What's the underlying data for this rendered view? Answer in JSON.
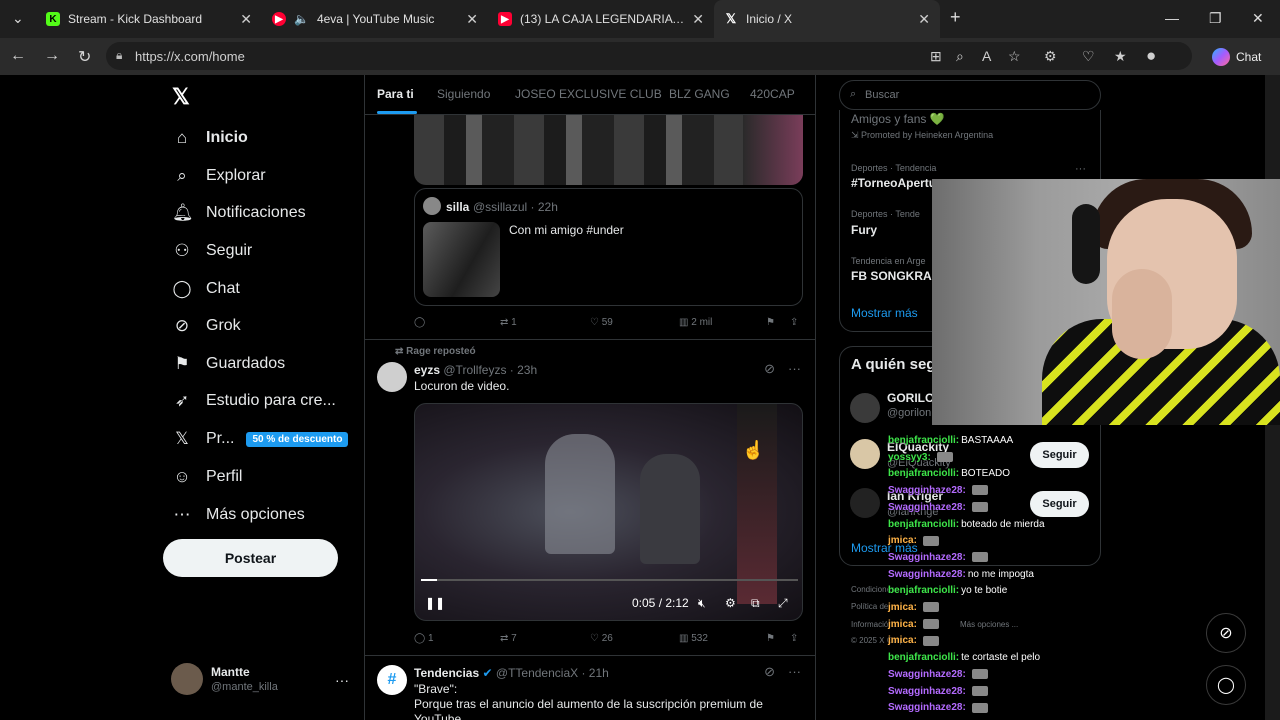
{
  "browser": {
    "tabs": [
      {
        "label": "Stream - Kick Dashboard",
        "icon": "kick-icon",
        "color": "#53fc18"
      },
      {
        "label": "4eva | YouTube Music",
        "icon": "youtube-music-icon",
        "color": "#ff0033"
      },
      {
        "label": "(13) LA CAJA LEGENDARIA - YouTube",
        "icon": "youtube-icon",
        "color": "#ff0033"
      },
      {
        "label": "Inicio / X",
        "icon": "x-icon",
        "color": "#ffffff"
      }
    ],
    "url": "https://x.com/home",
    "chat_label": "Chat"
  },
  "sidebar": {
    "items": [
      {
        "label": "Inicio",
        "icon": "home-icon"
      },
      {
        "label": "Explorar",
        "icon": "search-icon"
      },
      {
        "label": "Notificaciones",
        "icon": "bell-icon"
      },
      {
        "label": "Seguir",
        "icon": "add-person-icon"
      },
      {
        "label": "Chat",
        "icon": "chat-icon"
      },
      {
        "label": "Grok",
        "icon": "grok-icon"
      },
      {
        "label": "Guardados",
        "icon": "bookmark-icon"
      },
      {
        "label": "Estudio para cre...",
        "icon": "rocket-icon"
      },
      {
        "label": "Pr...",
        "icon": "x-premium-icon"
      },
      {
        "label": "Perfil",
        "icon": "person-icon"
      },
      {
        "label": "Más opciones",
        "icon": "more-circle-icon"
      }
    ],
    "premium_badge": "50 % de descuento",
    "post_button": "Postear",
    "account": {
      "name": "Mantte",
      "handle": "@mante_killa"
    }
  },
  "feed": {
    "tabs": [
      "Para ti",
      "Siguiendo",
      "JOSEO EXCLUSIVE CLUB",
      "BLZ GANG",
      "420CAP"
    ],
    "quote": {
      "name": "silla",
      "handle": "@ssillazul · 22h",
      "text": "Con mi amigo #under"
    },
    "post1_actions": {
      "replies": "",
      "reposts": "1",
      "likes": "59",
      "views": "2 mil"
    },
    "post2": {
      "repost_label": "Rage reposteó",
      "name": "eyzs",
      "handle": "@Trollfeyzs · 23h",
      "text": "Locuron de video.",
      "video_time": "0:05 / 2:12",
      "actions": {
        "replies": "1",
        "reposts": "7",
        "likes": "26",
        "views": "532"
      }
    },
    "post3": {
      "name": "Tendencias",
      "handle": "@TTendenciaX · 21h",
      "text1": "\"Brave\":",
      "text2": "Porque tras el anuncio del aumento de la suscripción premium de YouTube,"
    }
  },
  "right": {
    "search_placeholder": "Buscar",
    "promo_text": "Amigos y fans 💚",
    "promo_by": "Promoted by Heineken Argentina",
    "trends": [
      {
        "ctx": "Deportes · Tendencia",
        "name": "#TorneoApertu"
      },
      {
        "ctx": "Deportes · Tende",
        "name": "Fury"
      },
      {
        "ctx": "Tendencia en Arge",
        "name": "FB SONGKRAN"
      }
    ],
    "show_more": "Mostrar más",
    "who_title": "A quién seg",
    "who": [
      {
        "name": "GORILOI",
        "handle": "@gorilon"
      },
      {
        "name": "EIQuackity",
        "handle": "@ElQuackity"
      },
      {
        "name": "Ian Kriger",
        "handle": "@ianKrige"
      }
    ],
    "follow_label": "Seguir",
    "show_more2": "Mostrar más",
    "footer": [
      "Condiciones...",
      "Política de...",
      "Información...",
      "Más opciones ...",
      "© 2025 X Corp."
    ]
  },
  "chat_overlay": [
    {
      "user": "benjafranciolli:",
      "msg": "BASTAAAA",
      "c": "u1"
    },
    {
      "user": "yossyy3:",
      "msg": "",
      "c": "u1"
    },
    {
      "user": "benjafranciolli:",
      "msg": "BOTEADO",
      "c": "u1"
    },
    {
      "user": "Swagginhaze28:",
      "msg": "",
      "c": "u2"
    },
    {
      "user": "Swagginhaze28:",
      "msg": "",
      "c": "u2"
    },
    {
      "user": "benjafranciolli:",
      "msg": "boteado de mierda",
      "c": "u1"
    },
    {
      "user": "jmica:",
      "msg": "",
      "c": "u3"
    },
    {
      "user": "Swagginhaze28:",
      "msg": "",
      "c": "u2"
    },
    {
      "user": "Swagginhaze28:",
      "msg": "no me impogta",
      "c": "u2"
    },
    {
      "user": "benjafranciolli:",
      "msg": "yo te botie",
      "c": "u1"
    },
    {
      "user": "jmica:",
      "msg": "",
      "c": "u3"
    },
    {
      "user": "jmica:",
      "msg": "",
      "c": "u3"
    },
    {
      "user": "jmica:",
      "msg": "",
      "c": "u3"
    },
    {
      "user": "benjafranciolli:",
      "msg": "te cortaste el pelo",
      "c": "u1"
    },
    {
      "user": "Swagginhaze28:",
      "msg": "",
      "c": "u2"
    },
    {
      "user": "Swagginhaze28:",
      "msg": "",
      "c": "u2"
    },
    {
      "user": "Swagginhaze28:",
      "msg": "",
      "c": "u2"
    }
  ]
}
